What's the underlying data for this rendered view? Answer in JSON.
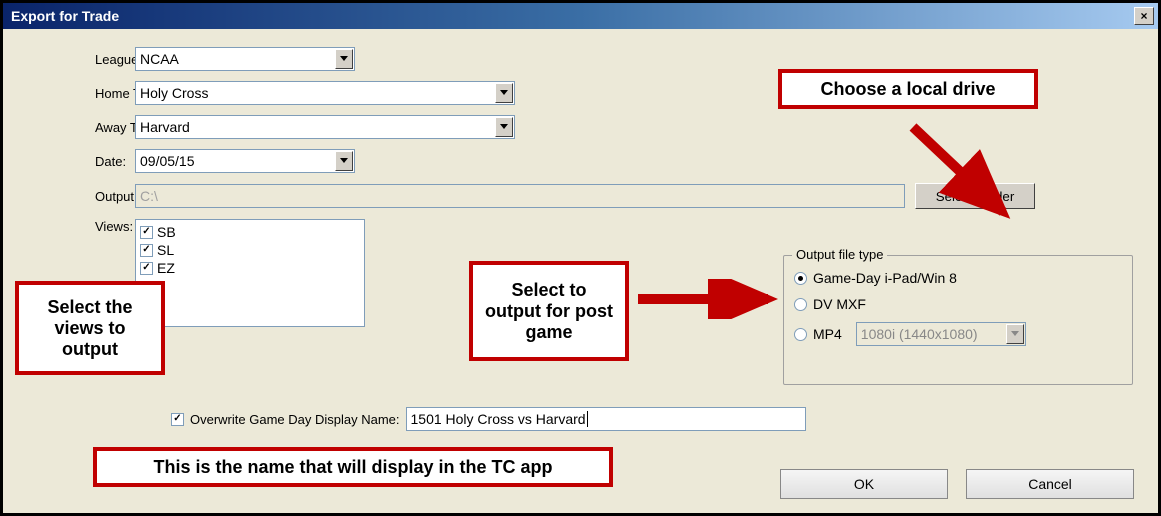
{
  "window": {
    "title": "Export for Trade",
    "close_label": "×"
  },
  "labels": {
    "league": "League:",
    "home_team": "Home Team:",
    "away_team": "Away Team:",
    "date": "Date:",
    "output_folder": "Output Folder:",
    "views": "Views:",
    "overwrite": "Overwrite Game Day Display Name:",
    "output_file_type": "Output file type"
  },
  "values": {
    "league": "NCAA",
    "home_team": "Holy Cross",
    "away_team": "Harvard",
    "date": "09/05/15",
    "output_folder": "C:\\",
    "display_name": "1501 Holy Cross vs Harvard",
    "mp4_res": "1080i (1440x1080)"
  },
  "views_list": [
    "SB",
    "SL",
    "EZ"
  ],
  "output_types": {
    "opt1": "Game-Day i-Pad/Win 8",
    "opt2": "DV MXF",
    "opt3": "MP4"
  },
  "buttons": {
    "select_folder": "Select Folder",
    "ok": "OK",
    "cancel": "Cancel"
  },
  "annotations": {
    "choose_drive": "Choose a local drive",
    "select_views": "Select the views to output",
    "select_output": "Select to output for post game",
    "display_name_note": "This is the name that will display in the TC app"
  }
}
